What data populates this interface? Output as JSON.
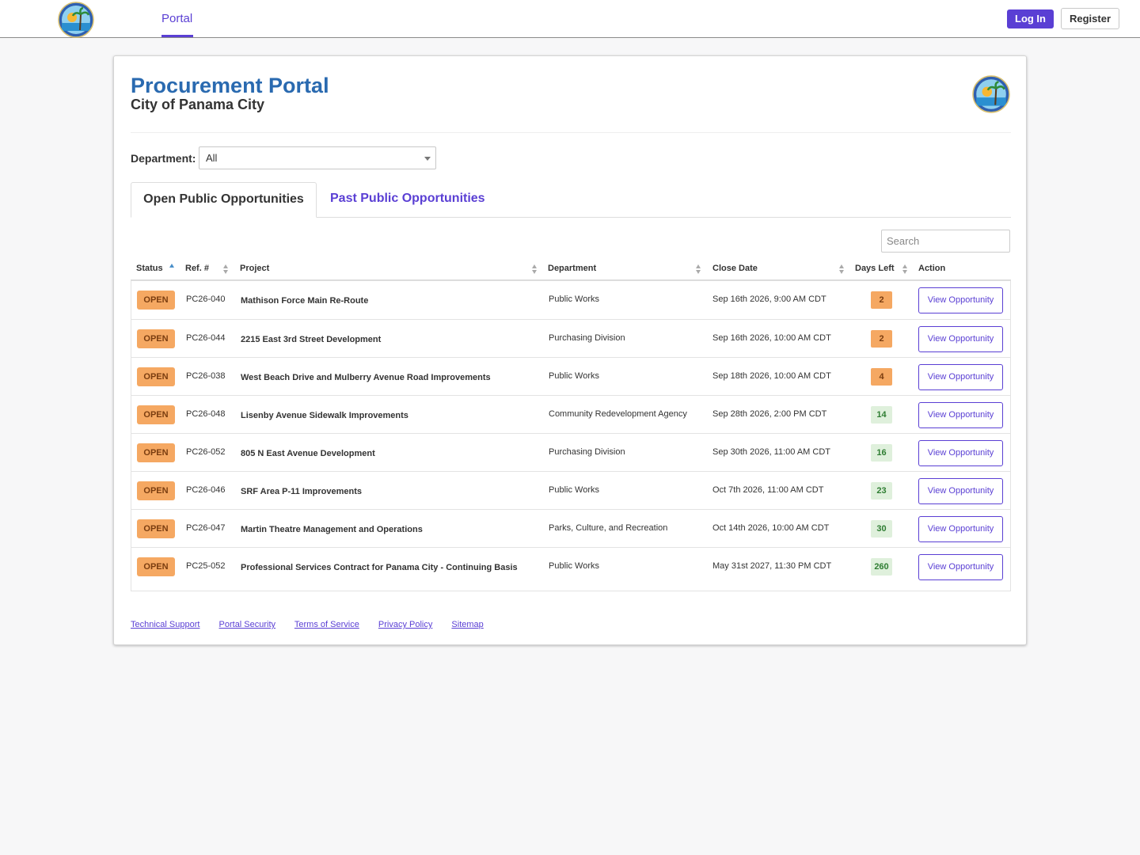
{
  "nav": {
    "portal_label": "Portal",
    "login_label": "Log In",
    "register_label": "Register"
  },
  "header": {
    "title": "Procurement Portal",
    "subtitle": "City of Panama City"
  },
  "filter": {
    "department_label": "Department:",
    "department_value": "All"
  },
  "tabs": [
    {
      "label": "Open Public Opportunities",
      "active": true
    },
    {
      "label": "Past Public Opportunities",
      "active": false
    }
  ],
  "search": {
    "placeholder": "Search"
  },
  "table": {
    "columns": [
      "Status",
      "Ref. #",
      "Project",
      "Department",
      "Close Date",
      "Days Left",
      "Action"
    ],
    "rows": [
      {
        "status": "OPEN",
        "ref": "PC26-040",
        "project": "Mathison Force Main Re-Route",
        "department": "Public Works",
        "close_date": "Sep 16th 2026, 9:00 AM CDT",
        "days_left": "2",
        "action": "View Opportunity"
      },
      {
        "status": "OPEN",
        "ref": "PC26-044",
        "project": "2215 East 3rd Street Development",
        "department": "Purchasing Division",
        "close_date": "Sep 16th 2026, 10:00 AM CDT",
        "days_left": "2",
        "action": "View Opportunity"
      },
      {
        "status": "OPEN",
        "ref": "PC26-038",
        "project": "West Beach Drive and Mulberry Avenue Road Improvements",
        "department": "Public Works",
        "close_date": "Sep 18th 2026, 10:00 AM CDT",
        "days_left": "4",
        "action": "View Opportunity"
      },
      {
        "status": "OPEN",
        "ref": "PC26-048",
        "project": "Lisenby Avenue Sidewalk Improvements",
        "department": "Community Redevelopment Agency",
        "close_date": "Sep 28th 2026, 2:00 PM CDT",
        "days_left": "14",
        "action": "View Opportunity"
      },
      {
        "status": "OPEN",
        "ref": "PC26-052",
        "project": "805 N East Avenue Development",
        "department": "Purchasing Division",
        "close_date": "Sep 30th 2026, 11:00 AM CDT",
        "days_left": "16",
        "action": "View Opportunity"
      },
      {
        "status": "OPEN",
        "ref": "PC26-046",
        "project": "SRF Area P-11 Improvements",
        "department": "Public Works",
        "close_date": "Oct 7th 2026, 11:00 AM CDT",
        "days_left": "23",
        "action": "View Opportunity"
      },
      {
        "status": "OPEN",
        "ref": "PC26-047",
        "project": "Martin Theatre Management and Operations",
        "department": "Parks, Culture, and Recreation",
        "close_date": "Oct 14th 2026, 10:00 AM CDT",
        "days_left": "30",
        "action": "View Opportunity"
      },
      {
        "status": "OPEN",
        "ref": "PC25-052",
        "project": "Professional Services Contract for Panama City - Continuing Basis",
        "department": "Public Works",
        "close_date": "May 31st 2027, 11:30 PM CDT",
        "days_left": "260",
        "action": "View Opportunity"
      }
    ]
  },
  "footer": {
    "links": [
      "Technical Support",
      "Portal Security",
      "Terms of Service",
      "Privacy Policy",
      "Sitemap"
    ]
  },
  "colors": {
    "accent": "#5a3fd4",
    "title_blue": "#2a6ab0",
    "open_badge": "#f5a862",
    "days_ok_bg": "#dff0dc"
  },
  "icons": {
    "logo": "city-seal-icon",
    "sort": "sort-icon"
  }
}
